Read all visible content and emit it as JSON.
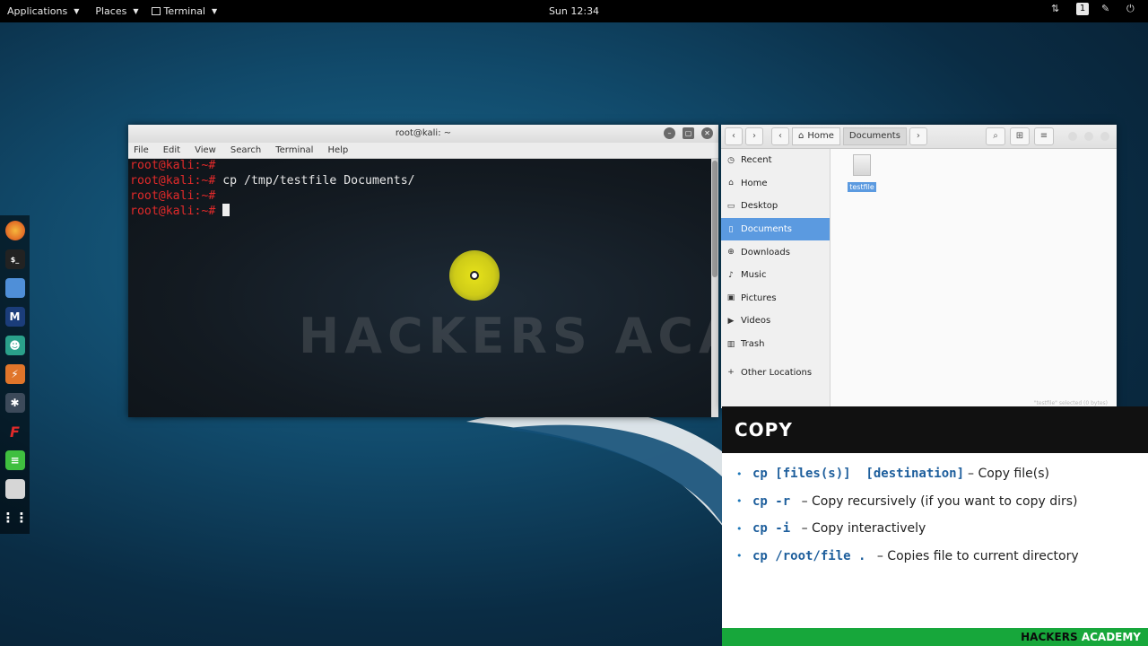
{
  "topbar": {
    "applications": "Applications",
    "places": "Places",
    "terminal": "Terminal",
    "clock": "Sun 12:34",
    "workspace": "1"
  },
  "dock": {
    "items": [
      "firefox-icon",
      "terminal-icon",
      "files-icon",
      "metasploit-icon",
      "armitage-icon",
      "burpsuite-icon",
      "maltego-icon",
      "faraday-icon",
      "leafpad-icon",
      "screenshot-icon",
      "show-apps-icon"
    ]
  },
  "terminal": {
    "title": "root@kali: ~",
    "menu": [
      "File",
      "Edit",
      "View",
      "Search",
      "Terminal",
      "Help"
    ],
    "lines": [
      {
        "prompt": "root@kali:~#",
        "cmd": ""
      },
      {
        "prompt": "root@kali:~#",
        "cmd": " cp /tmp/testfile Documents/"
      },
      {
        "prompt": "root@kali:~#",
        "cmd": ""
      },
      {
        "prompt": "root@kali:~#",
        "cmd": " "
      }
    ],
    "watermark": "HACKERS ACADEMY"
  },
  "filemanager": {
    "breadcrumb": [
      "Home",
      "Documents"
    ],
    "sidebar": [
      {
        "label": "Recent",
        "icon": "clock-icon"
      },
      {
        "label": "Home",
        "icon": "home-icon"
      },
      {
        "label": "Desktop",
        "icon": "desktop-icon"
      },
      {
        "label": "Documents",
        "icon": "document-icon",
        "selected": true
      },
      {
        "label": "Downloads",
        "icon": "download-icon"
      },
      {
        "label": "Music",
        "icon": "music-icon"
      },
      {
        "label": "Pictures",
        "icon": "picture-icon"
      },
      {
        "label": "Videos",
        "icon": "video-icon"
      },
      {
        "label": "Trash",
        "icon": "trash-icon"
      },
      {
        "label": "Other Locations",
        "icon": "plus-icon"
      }
    ],
    "file": "testfile",
    "status": "\"testfile\" selected (0 bytes)"
  },
  "slide": {
    "title": "COPY",
    "items": [
      {
        "code": "cp [files(s)]  [destination]",
        "text": "– Copy file(s)"
      },
      {
        "code": "cp -r ",
        "text": "– Copy recursively (if you want to copy dirs)"
      },
      {
        "code": "cp -i ",
        "text": "– Copy interactively"
      },
      {
        "code": "cp /root/file . ",
        "text": "– Copies file to current directory"
      }
    ],
    "footer_a": "HACKERS ",
    "footer_b": "ACADEMY"
  }
}
